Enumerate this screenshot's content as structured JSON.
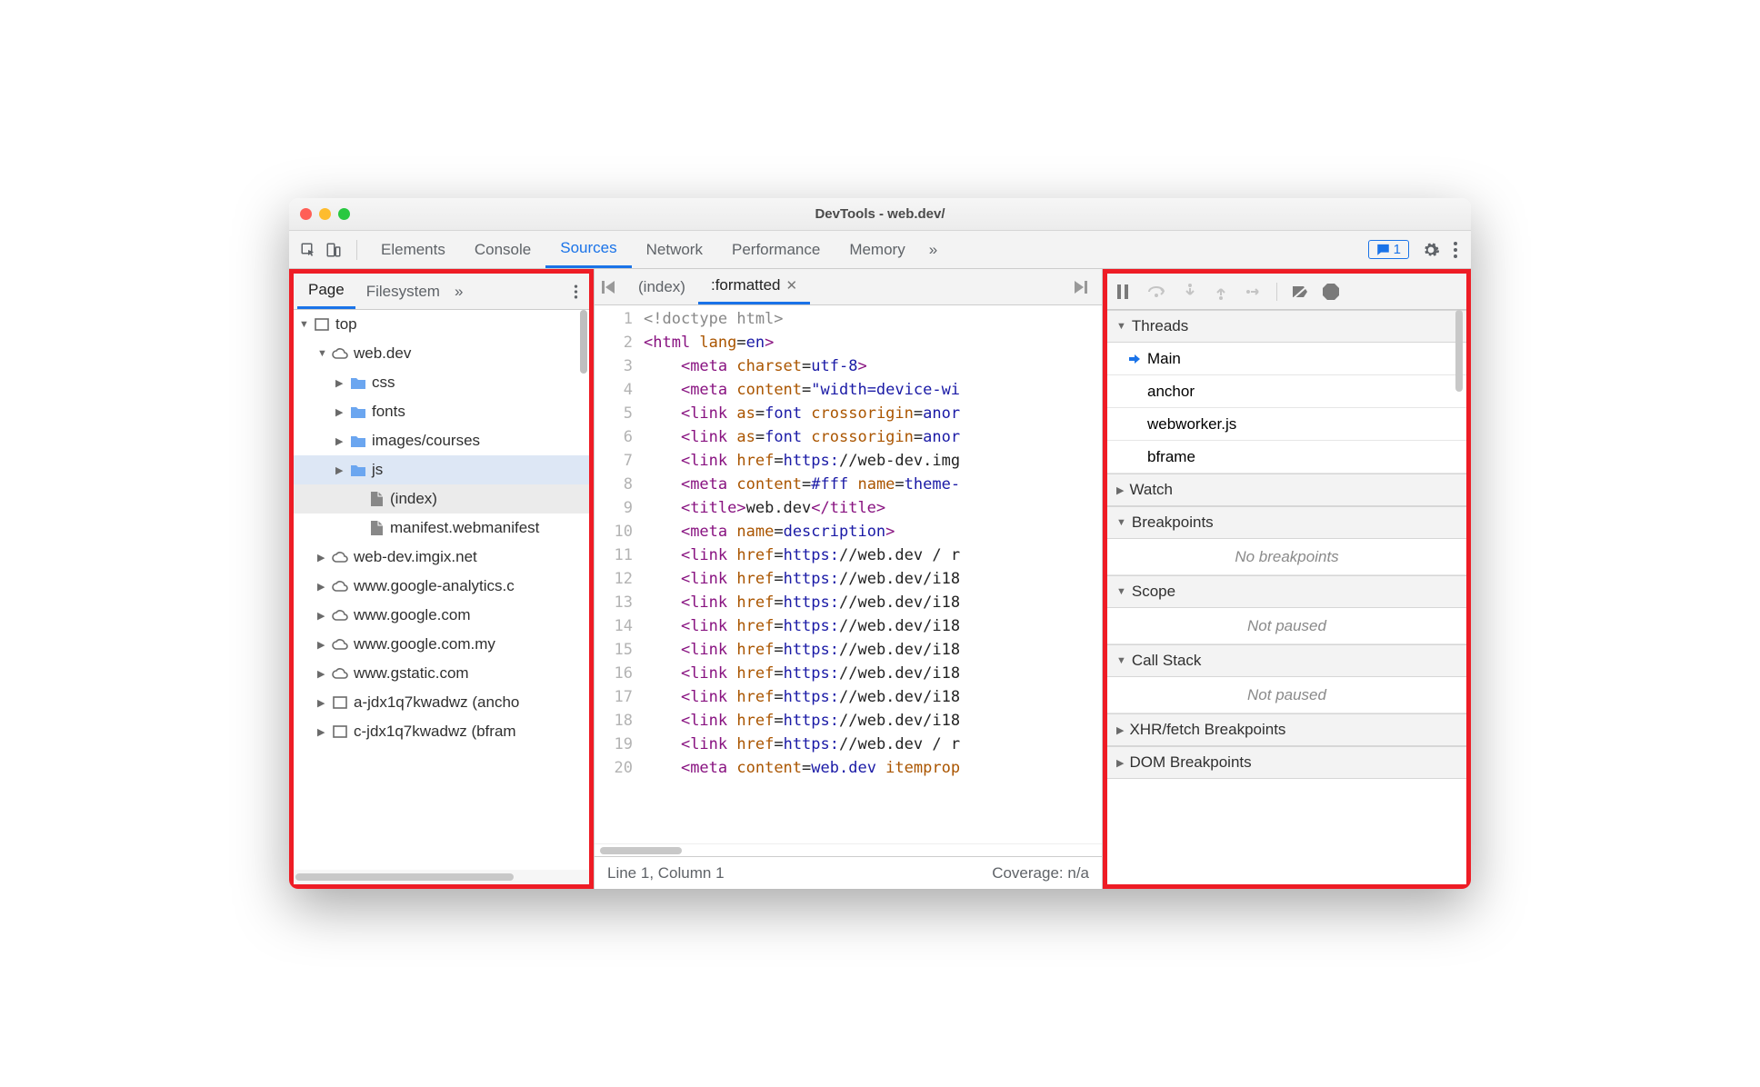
{
  "window": {
    "title": "DevTools - web.dev/"
  },
  "tabs": {
    "items": [
      "Elements",
      "Console",
      "Sources",
      "Network",
      "Performance",
      "Memory"
    ],
    "active": "Sources",
    "more": "»",
    "badge": {
      "icon": "message",
      "count": "1"
    }
  },
  "nav": {
    "tabs": [
      "Page",
      "Filesystem"
    ],
    "active": "Page",
    "more": "»",
    "tree": [
      {
        "depth": 0,
        "arrow": "▼",
        "icon": "frame",
        "label": "top"
      },
      {
        "depth": 1,
        "arrow": "▼",
        "icon": "cloud",
        "label": "web.dev"
      },
      {
        "depth": 2,
        "arrow": "▶",
        "icon": "folder",
        "label": "css"
      },
      {
        "depth": 2,
        "arrow": "▶",
        "icon": "folder",
        "label": "fonts"
      },
      {
        "depth": 2,
        "arrow": "▶",
        "icon": "folder",
        "label": "images/courses"
      },
      {
        "depth": 2,
        "arrow": "▶",
        "icon": "folder",
        "label": "js",
        "selected": "1"
      },
      {
        "depth": 3,
        "arrow": "",
        "icon": "file",
        "label": "(index)",
        "highlight": "1"
      },
      {
        "depth": 3,
        "arrow": "",
        "icon": "file",
        "label": "manifest.webmanifest"
      },
      {
        "depth": 1,
        "arrow": "▶",
        "icon": "cloud",
        "label": "web-dev.imgix.net"
      },
      {
        "depth": 1,
        "arrow": "▶",
        "icon": "cloud",
        "label": "www.google-analytics.c"
      },
      {
        "depth": 1,
        "arrow": "▶",
        "icon": "cloud",
        "label": "www.google.com"
      },
      {
        "depth": 1,
        "arrow": "▶",
        "icon": "cloud",
        "label": "www.google.com.my"
      },
      {
        "depth": 1,
        "arrow": "▶",
        "icon": "cloud",
        "label": "www.gstatic.com"
      },
      {
        "depth": 1,
        "arrow": "▶",
        "icon": "frame",
        "label": "a-jdx1q7kwadwz (ancho"
      },
      {
        "depth": 1,
        "arrow": "▶",
        "icon": "frame",
        "label": "c-jdx1q7kwadwz (bfram"
      }
    ]
  },
  "editor": {
    "tabs": [
      {
        "label": "(index)",
        "closable": false,
        "active": false
      },
      {
        "label": ":formatted",
        "closable": true,
        "active": true
      }
    ],
    "lines": [
      {
        "n": "1",
        "tokens": [
          [
            "doctype",
            "<!doctype html>"
          ]
        ]
      },
      {
        "n": "2",
        "tokens": [
          [
            "tag",
            "<html "
          ],
          [
            "attr",
            "lang"
          ],
          [
            "plain",
            "="
          ],
          [
            "str",
            "en"
          ],
          [
            "tag",
            ">"
          ]
        ]
      },
      {
        "n": "3",
        "tokens": [
          [
            "indent",
            "    "
          ],
          [
            "tag",
            "<meta "
          ],
          [
            "attr",
            "charset"
          ],
          [
            "plain",
            "="
          ],
          [
            "str",
            "utf-8"
          ],
          [
            "tag",
            ">"
          ]
        ]
      },
      {
        "n": "4",
        "tokens": [
          [
            "indent",
            "    "
          ],
          [
            "tag",
            "<meta "
          ],
          [
            "attr",
            "content"
          ],
          [
            "plain",
            "="
          ],
          [
            "str",
            "\"width=device-wi"
          ]
        ]
      },
      {
        "n": "5",
        "tokens": [
          [
            "indent",
            "    "
          ],
          [
            "tag",
            "<link "
          ],
          [
            "attr",
            "as"
          ],
          [
            "plain",
            "="
          ],
          [
            "str",
            "font "
          ],
          [
            "attr",
            "crossorigin"
          ],
          [
            "plain",
            "="
          ],
          [
            "str",
            "anor"
          ]
        ]
      },
      {
        "n": "6",
        "tokens": [
          [
            "indent",
            "    "
          ],
          [
            "tag",
            "<link "
          ],
          [
            "attr",
            "as"
          ],
          [
            "plain",
            "="
          ],
          [
            "str",
            "font "
          ],
          [
            "attr",
            "crossorigin"
          ],
          [
            "plain",
            "="
          ],
          [
            "str",
            "anor"
          ]
        ]
      },
      {
        "n": "7",
        "tokens": [
          [
            "indent",
            "    "
          ],
          [
            "tag",
            "<link "
          ],
          [
            "attr",
            "href"
          ],
          [
            "plain",
            "="
          ],
          [
            "str",
            "https:"
          ],
          [
            "plain",
            "//web-dev.img"
          ]
        ]
      },
      {
        "n": "8",
        "tokens": [
          [
            "indent",
            "    "
          ],
          [
            "tag",
            "<meta "
          ],
          [
            "attr",
            "content"
          ],
          [
            "plain",
            "="
          ],
          [
            "str",
            "#fff "
          ],
          [
            "attr",
            "name"
          ],
          [
            "plain",
            "="
          ],
          [
            "str",
            "theme-"
          ]
        ]
      },
      {
        "n": "9",
        "tokens": [
          [
            "indent",
            "    "
          ],
          [
            "tag",
            "<title>"
          ],
          [
            "title",
            "web.dev"
          ],
          [
            "tag",
            "</title>"
          ]
        ]
      },
      {
        "n": "10",
        "tokens": [
          [
            "indent",
            "    "
          ],
          [
            "tag",
            "<meta "
          ],
          [
            "attr",
            "name"
          ],
          [
            "plain",
            "="
          ],
          [
            "str",
            "description"
          ],
          [
            "tag",
            ">"
          ]
        ]
      },
      {
        "n": "11",
        "tokens": [
          [
            "indent",
            "    "
          ],
          [
            "tag",
            "<link "
          ],
          [
            "attr",
            "href"
          ],
          [
            "plain",
            "="
          ],
          [
            "str",
            "https:"
          ],
          [
            "plain",
            "//web.dev / r"
          ]
        ]
      },
      {
        "n": "12",
        "tokens": [
          [
            "indent",
            "    "
          ],
          [
            "tag",
            "<link "
          ],
          [
            "attr",
            "href"
          ],
          [
            "plain",
            "="
          ],
          [
            "str",
            "https:"
          ],
          [
            "plain",
            "//web.dev/i18"
          ]
        ]
      },
      {
        "n": "13",
        "tokens": [
          [
            "indent",
            "    "
          ],
          [
            "tag",
            "<link "
          ],
          [
            "attr",
            "href"
          ],
          [
            "plain",
            "="
          ],
          [
            "str",
            "https:"
          ],
          [
            "plain",
            "//web.dev/i18"
          ]
        ]
      },
      {
        "n": "14",
        "tokens": [
          [
            "indent",
            "    "
          ],
          [
            "tag",
            "<link "
          ],
          [
            "attr",
            "href"
          ],
          [
            "plain",
            "="
          ],
          [
            "str",
            "https:"
          ],
          [
            "plain",
            "//web.dev/i18"
          ]
        ]
      },
      {
        "n": "15",
        "tokens": [
          [
            "indent",
            "    "
          ],
          [
            "tag",
            "<link "
          ],
          [
            "attr",
            "href"
          ],
          [
            "plain",
            "="
          ],
          [
            "str",
            "https:"
          ],
          [
            "plain",
            "//web.dev/i18"
          ]
        ]
      },
      {
        "n": "16",
        "tokens": [
          [
            "indent",
            "    "
          ],
          [
            "tag",
            "<link "
          ],
          [
            "attr",
            "href"
          ],
          [
            "plain",
            "="
          ],
          [
            "str",
            "https:"
          ],
          [
            "plain",
            "//web.dev/i18"
          ]
        ]
      },
      {
        "n": "17",
        "tokens": [
          [
            "indent",
            "    "
          ],
          [
            "tag",
            "<link "
          ],
          [
            "attr",
            "href"
          ],
          [
            "plain",
            "="
          ],
          [
            "str",
            "https:"
          ],
          [
            "plain",
            "//web.dev/i18"
          ]
        ]
      },
      {
        "n": "18",
        "tokens": [
          [
            "indent",
            "    "
          ],
          [
            "tag",
            "<link "
          ],
          [
            "attr",
            "href"
          ],
          [
            "plain",
            "="
          ],
          [
            "str",
            "https:"
          ],
          [
            "plain",
            "//web.dev/i18"
          ]
        ]
      },
      {
        "n": "19",
        "tokens": [
          [
            "indent",
            "    "
          ],
          [
            "tag",
            "<link "
          ],
          [
            "attr",
            "href"
          ],
          [
            "plain",
            "="
          ],
          [
            "str",
            "https:"
          ],
          [
            "plain",
            "//web.dev / r"
          ]
        ]
      },
      {
        "n": "20",
        "tokens": [
          [
            "indent",
            "    "
          ],
          [
            "tag",
            "<meta "
          ],
          [
            "attr",
            "content"
          ],
          [
            "plain",
            "="
          ],
          [
            "str",
            "web.dev "
          ],
          [
            "attr",
            "itemprop"
          ]
        ]
      }
    ],
    "status": {
      "pos": "Line 1, Column 1",
      "coverage": "Coverage: n/a"
    }
  },
  "debugger": {
    "sections": [
      {
        "title": "Threads",
        "expanded": true,
        "items": [
          {
            "label": "Main",
            "current": true
          },
          {
            "label": "anchor"
          },
          {
            "label": "webworker.js"
          },
          {
            "label": "bframe"
          }
        ]
      },
      {
        "title": "Watch",
        "expanded": false
      },
      {
        "title": "Breakpoints",
        "expanded": true,
        "empty": "No breakpoints"
      },
      {
        "title": "Scope",
        "expanded": true,
        "empty": "Not paused"
      },
      {
        "title": "Call Stack",
        "expanded": true,
        "empty": "Not paused"
      },
      {
        "title": "XHR/fetch Breakpoints",
        "expanded": false
      },
      {
        "title": "DOM Breakpoints",
        "expanded": false
      }
    ]
  }
}
